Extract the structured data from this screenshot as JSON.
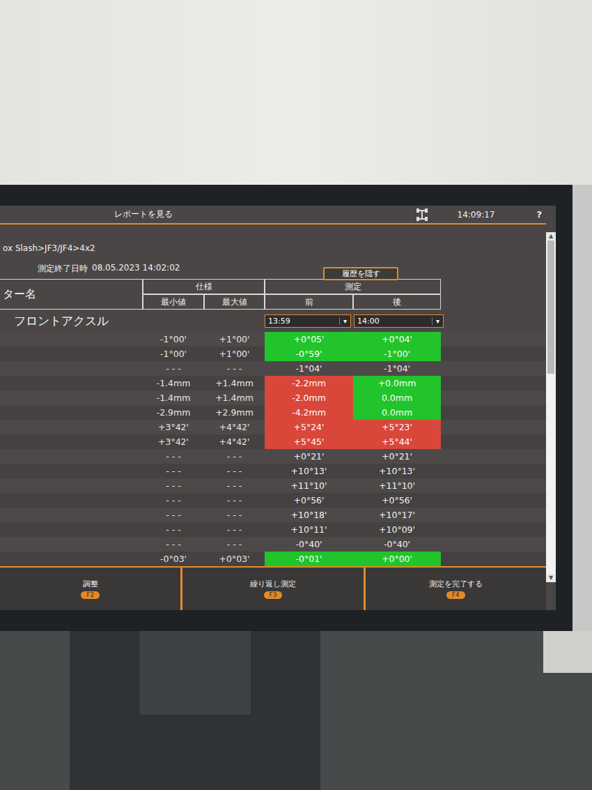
{
  "header": {
    "title": "レポートを見る",
    "time": "14:09:17",
    "help": "?"
  },
  "breadcrumb": "ox Slash>JF3/JF4>4x2",
  "measured_at": {
    "label": "測定終了日時",
    "value": "08.05.2023 14:02:02"
  },
  "history_button": "履歴を隠す",
  "table": {
    "name_header": "ター名",
    "spec_header": "仕様",
    "min_header": "最小値",
    "max_header": "最大値",
    "measure_header": "測定",
    "before_header": "前",
    "after_header": "後",
    "section": "フロントアクスル",
    "before_time": {
      "value": "13:59",
      "arrow": "▾"
    },
    "after_time": {
      "value": "14:00",
      "arrow": "▾"
    },
    "rows": [
      {
        "min": "-1°00'",
        "max": "+1°00'",
        "before": {
          "value": "+0°05'",
          "status": "ok"
        },
        "after": {
          "value": "+0°04'",
          "status": "ok"
        }
      },
      {
        "min": "-1°00'",
        "max": "+1°00'",
        "before": {
          "value": "-0°59'",
          "status": "ok"
        },
        "after": {
          "value": "-1°00'",
          "status": "ok"
        }
      },
      {
        "min": "- - -",
        "max": "- - -",
        "before": {
          "value": "-1°04'",
          "status": "none"
        },
        "after": {
          "value": "-1°04'",
          "status": "none"
        }
      },
      {
        "min": "-1.4mm",
        "max": "+1.4mm",
        "before": {
          "value": "-2.2mm",
          "status": "bad"
        },
        "after": {
          "value": "+0.0mm",
          "status": "ok"
        }
      },
      {
        "min": "-1.4mm",
        "max": "+1.4mm",
        "before": {
          "value": "-2.0mm",
          "status": "bad"
        },
        "after": {
          "value": "0.0mm",
          "status": "ok"
        }
      },
      {
        "min": "-2.9mm",
        "max": "+2.9mm",
        "before": {
          "value": "-4.2mm",
          "status": "bad"
        },
        "after": {
          "value": "0.0mm",
          "status": "ok"
        }
      },
      {
        "min": "+3°42'",
        "max": "+4°42'",
        "before": {
          "value": "+5°24'",
          "status": "bad"
        },
        "after": {
          "value": "+5°23'",
          "status": "bad"
        }
      },
      {
        "min": "+3°42'",
        "max": "+4°42'",
        "before": {
          "value": "+5°45'",
          "status": "bad"
        },
        "after": {
          "value": "+5°44'",
          "status": "bad"
        }
      },
      {
        "min": "- - -",
        "max": "- - -",
        "before": {
          "value": "+0°21'",
          "status": "none"
        },
        "after": {
          "value": "+0°21'",
          "status": "none"
        }
      },
      {
        "min": "- - -",
        "max": "- - -",
        "before": {
          "value": "+10°13'",
          "status": "none"
        },
        "after": {
          "value": "+10°13'",
          "status": "none"
        }
      },
      {
        "min": "- - -",
        "max": "- - -",
        "before": {
          "value": "+11°10'",
          "status": "none"
        },
        "after": {
          "value": "+11°10'",
          "status": "none"
        }
      },
      {
        "min": "- - -",
        "max": "- - -",
        "before": {
          "value": "+0°56'",
          "status": "none"
        },
        "after": {
          "value": "+0°56'",
          "status": "none"
        }
      },
      {
        "min": "- - -",
        "max": "- - -",
        "before": {
          "value": "+10°18'",
          "status": "none"
        },
        "after": {
          "value": "+10°17'",
          "status": "none"
        }
      },
      {
        "min": "- - -",
        "max": "- - -",
        "before": {
          "value": "+10°11'",
          "status": "none"
        },
        "after": {
          "value": "+10°09'",
          "status": "none"
        }
      },
      {
        "min": "- - -",
        "max": "- - -",
        "before": {
          "value": "-0°40'",
          "status": "none"
        },
        "after": {
          "value": "-0°40'",
          "status": "none"
        }
      },
      {
        "min": "-0°03'",
        "max": "+0°03'",
        "before": {
          "value": "-0°01'",
          "status": "ok"
        },
        "after": {
          "value": "+0°00'",
          "status": "ok"
        }
      }
    ]
  },
  "scrollbar": {
    "level": 0.4,
    "up": "▲",
    "down": "▼"
  },
  "footer": [
    {
      "label": "調整",
      "key": "F2"
    },
    {
      "label": "繰り返し測定",
      "key": "F3"
    },
    {
      "label": "測定を完了する",
      "key": "F4"
    }
  ]
}
